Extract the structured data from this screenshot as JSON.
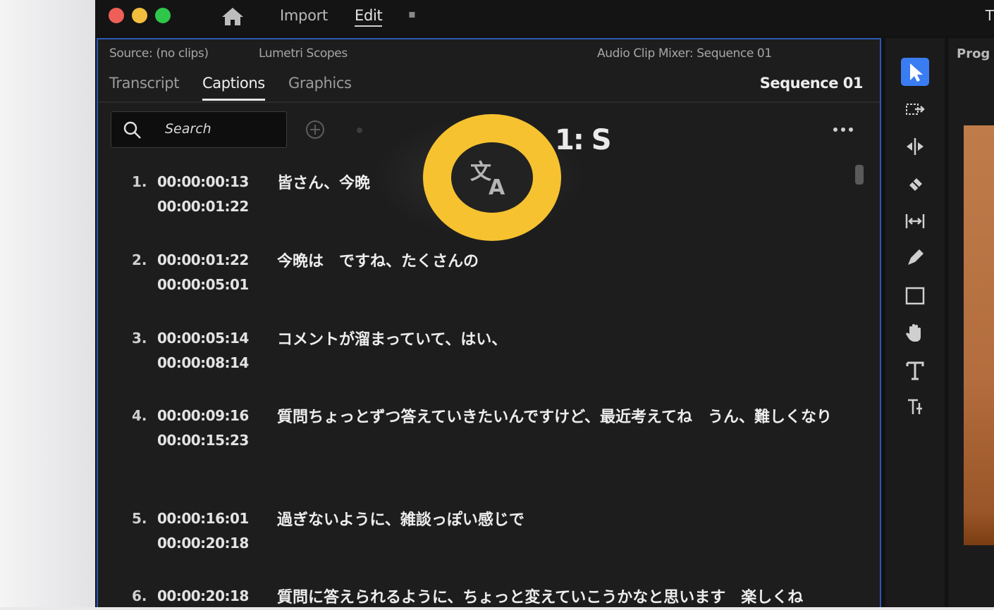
{
  "menu": {
    "import": "Import",
    "edit": "Edit",
    "more_glyph": "▪",
    "right_title": "T"
  },
  "panel_header": {
    "source": "Source: (no clips)",
    "lumetri": "Lumetri Scopes",
    "audio_mixer": "Audio Clip Mixer: Sequence 01"
  },
  "tabs": {
    "transcript": "Transcript",
    "captions": "Captions",
    "graphics": "Graphics"
  },
  "sequence_title": "Sequence 01",
  "sequence_partial": "1: S",
  "search": {
    "placeholder": "Search"
  },
  "captions": [
    {
      "index": "1.",
      "in": "00:00:00:13",
      "out": "00:00:01:22",
      "text": "皆さん、今晩"
    },
    {
      "index": "2.",
      "in": "00:00:01:22",
      "out": "00:00:05:01",
      "text": "今晩は　ですね、たくさんの"
    },
    {
      "index": "3.",
      "in": "00:00:05:14",
      "out": "00:00:08:14",
      "text": "コメントが溜まっていて、はい、"
    },
    {
      "index": "4.",
      "in": "00:00:09:16",
      "out": "00:00:15:23",
      "text": "質問ちょっとずつ答えていきたいんですけど、最近考えてね　うん、難しくなり"
    },
    {
      "index": "5.",
      "in": "00:00:16:01",
      "out": "00:00:20:18",
      "text": "過ぎないように、雑談っぽい感じで"
    },
    {
      "index": "6.",
      "in": "00:00:20:18",
      "out": "",
      "text": "質問に答えられるように、ちょっと変えていこうかなと思います　楽しくね"
    }
  ],
  "program": {
    "title": "Prog"
  },
  "icons": {
    "home": "home-icon",
    "search": "search-icon",
    "add": "add-circle-icon",
    "more": "more-horizontal-icon",
    "translate": "translate-icon",
    "tools": [
      "selection-tool-icon",
      "track-select-tool-icon",
      "ripple-edit-tool-icon",
      "razor-tool-icon",
      "slip-tool-icon",
      "pen-tool-icon",
      "rectangle-tool-icon",
      "hand-tool-icon",
      "type-tool-icon",
      "vertical-type-tool-icon"
    ]
  },
  "colors": {
    "accent_blue": "#3a7df2",
    "panel_border": "#2d59b3",
    "highlight_ring": "#f6c230",
    "traffic_red": "#ee5f58",
    "traffic_yellow": "#f2be3d",
    "traffic_green": "#2fc74a"
  }
}
